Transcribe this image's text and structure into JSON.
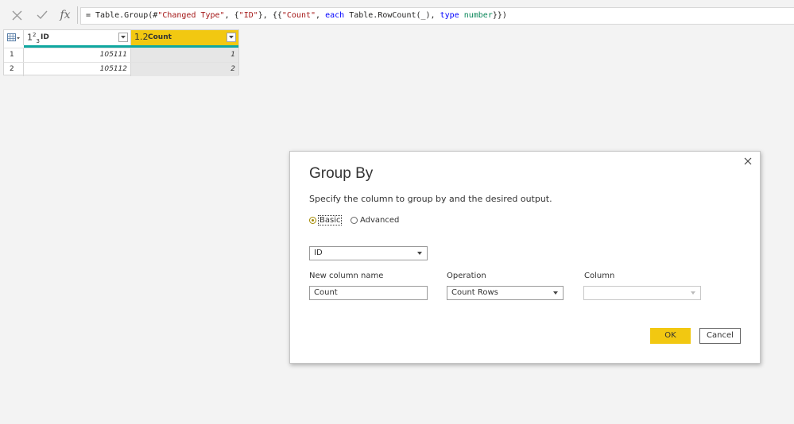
{
  "formula_bar": {
    "cancel_icon": "x-icon",
    "commit_icon": "check-icon",
    "fx_label": "fx",
    "parts": {
      "p1": "= Table.Group(#",
      "p2": "\"Changed Type\"",
      "p3": ", {",
      "p4": "\"ID\"",
      "p5": "}, {{",
      "p6": "\"Count\"",
      "p7": ", ",
      "p8": "each",
      "p9": " Table.RowCount(_), ",
      "p10": "type",
      "p11": " ",
      "p12": "number",
      "p13": "}})"
    }
  },
  "grid": {
    "columns": [
      {
        "type_icon_main": "1",
        "type_icon_sup": "2",
        "type_icon_sub": "3",
        "name": "ID"
      },
      {
        "type_icon": "1.2",
        "name": "Count"
      }
    ],
    "rows": [
      {
        "num": "1",
        "id": "105111",
        "count": "1"
      },
      {
        "num": "2",
        "id": "105112",
        "count": "2"
      }
    ],
    "colors": {
      "selected_header": "#f2c811",
      "quality_bar": "#0fa7a0"
    }
  },
  "dialog": {
    "title": "Group By",
    "description": "Specify the column to group by and the desired output.",
    "radio_basic": "Basic",
    "radio_advanced": "Advanced",
    "group_by_value": "ID",
    "new_column_label": "New column name",
    "new_column_value": "Count",
    "operation_label": "Operation",
    "operation_value": "Count Rows",
    "column_label": "Column",
    "column_value": "",
    "ok_label": "OK",
    "cancel_label": "Cancel",
    "accent_color": "#f2c811"
  }
}
